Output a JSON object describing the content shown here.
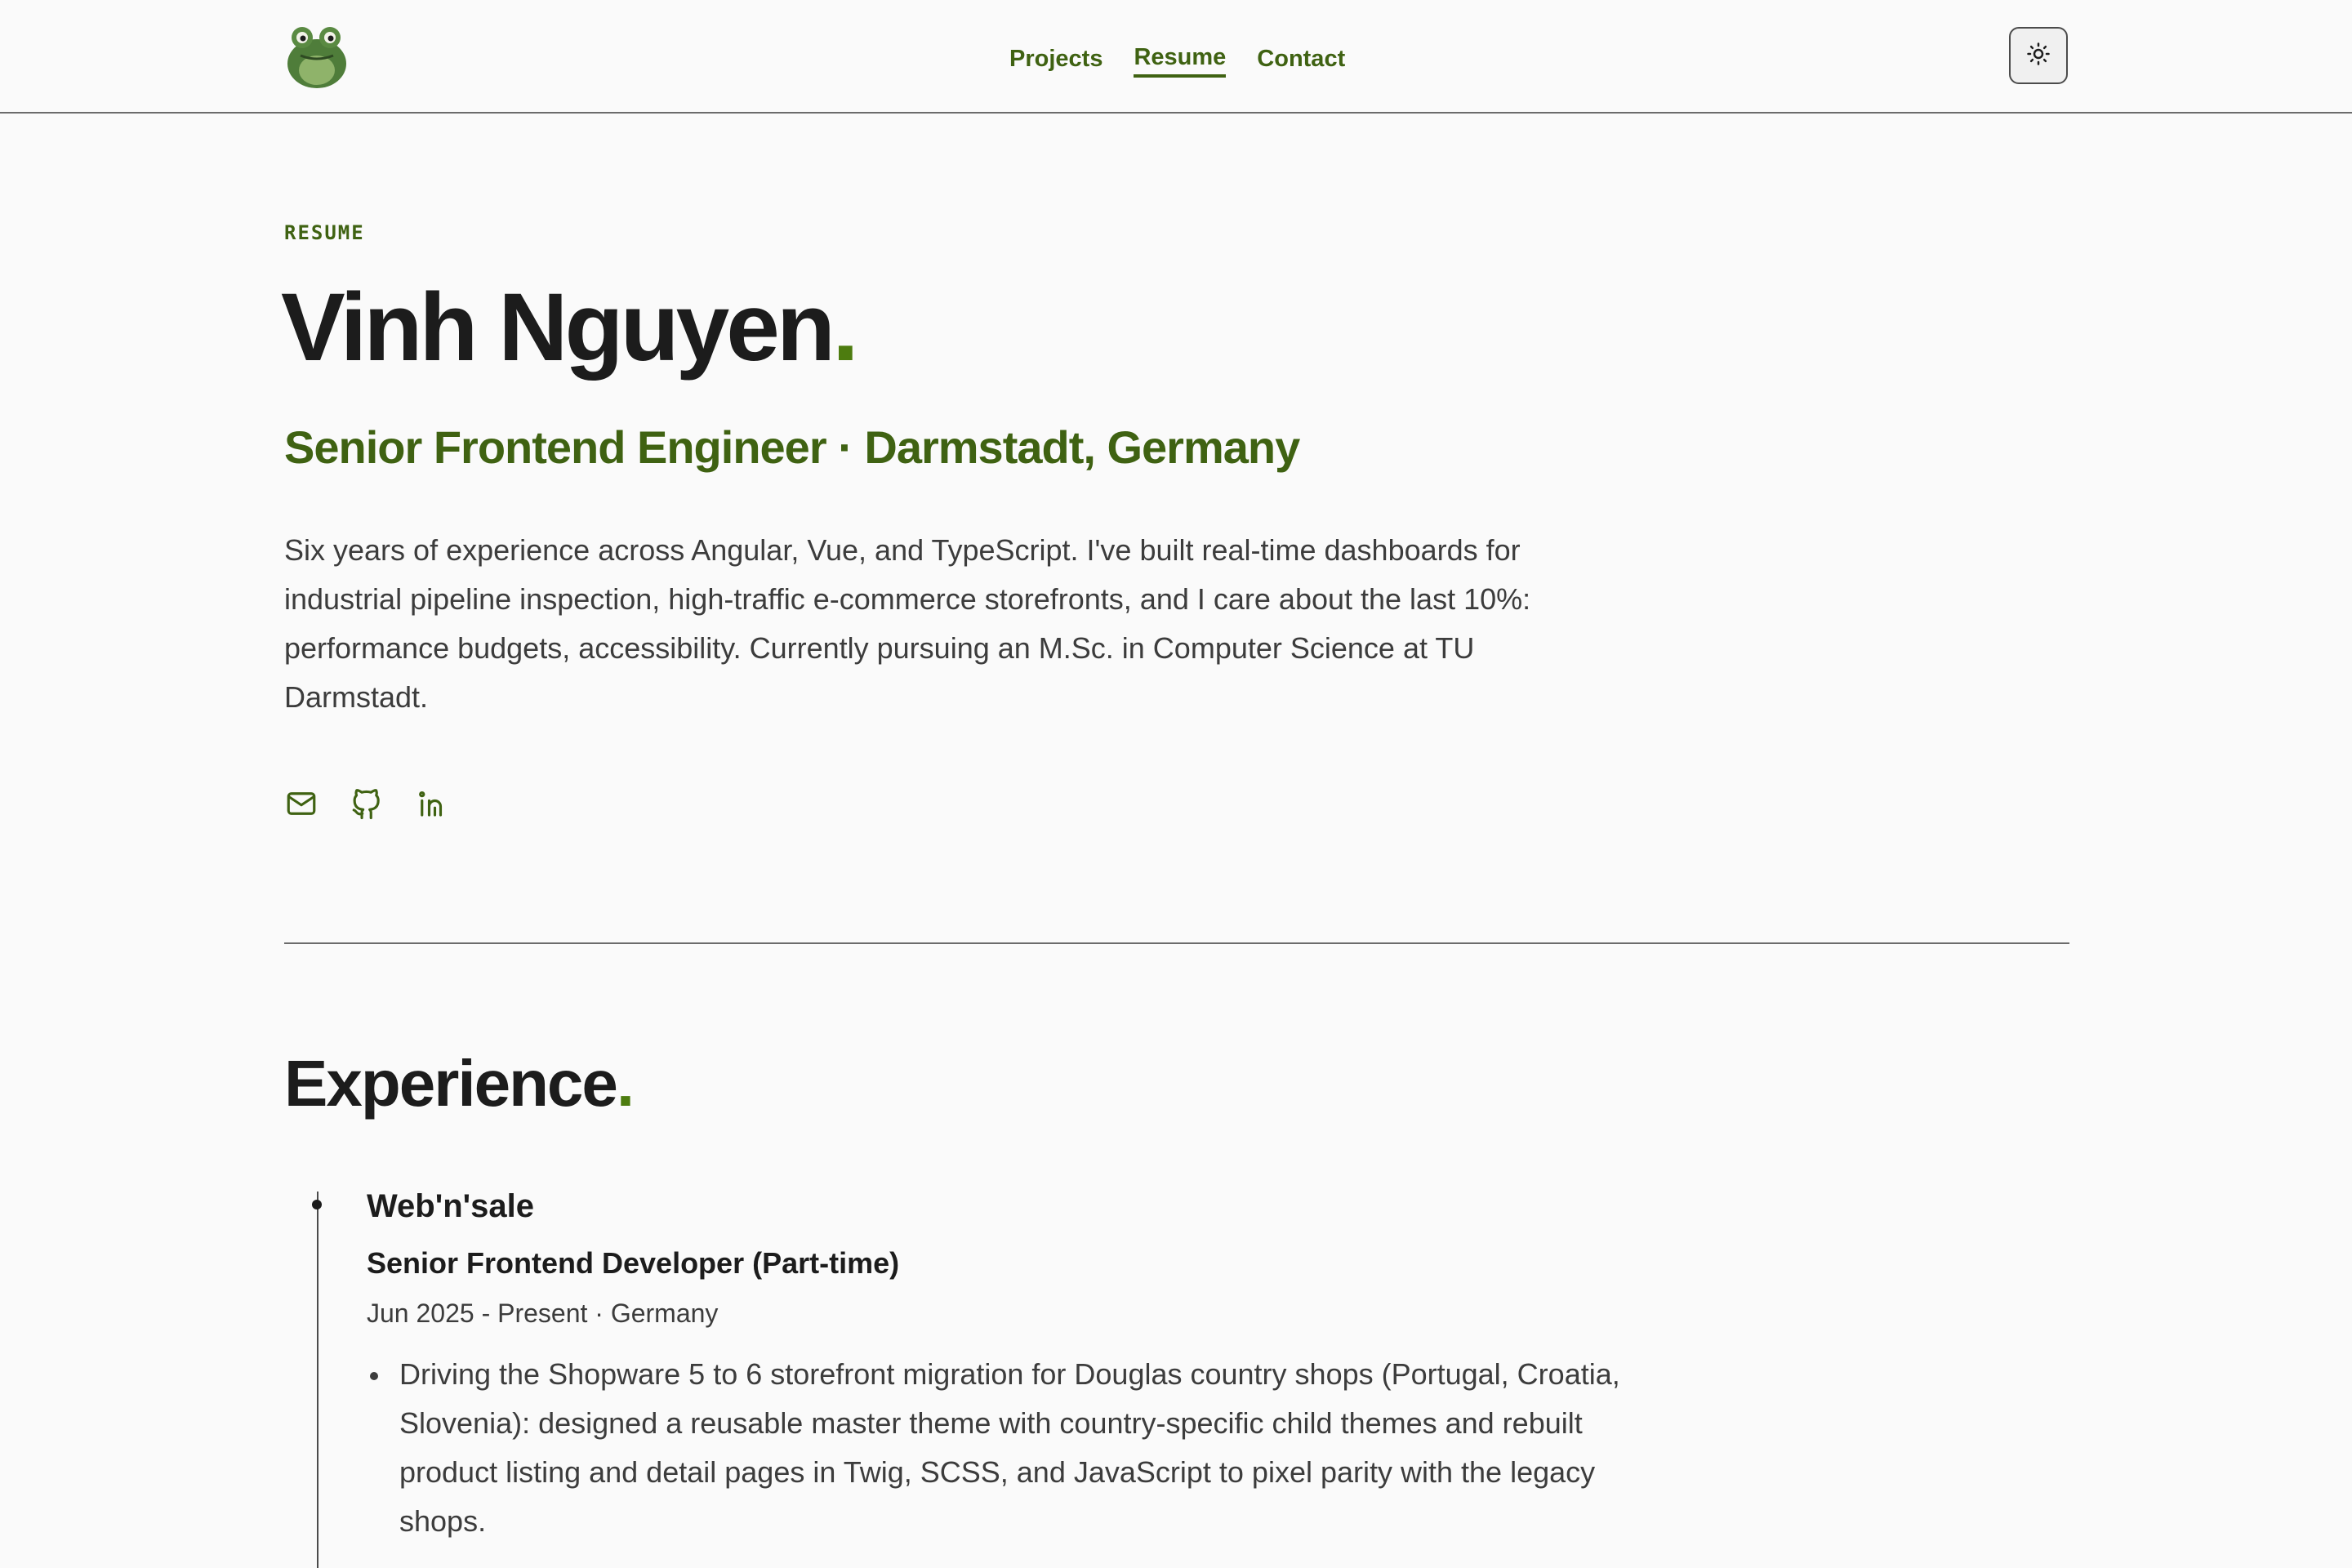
{
  "nav": {
    "links": [
      {
        "label": "Projects",
        "active": false
      },
      {
        "label": "Resume",
        "active": true
      },
      {
        "label": "Contact",
        "active": false
      }
    ],
    "logo_icon": "frog-avatar-icon",
    "theme_icon": "sun-icon"
  },
  "hero": {
    "eyebrow": "RESUME",
    "name": "Vinh Nguyen",
    "name_dot": ".",
    "subtitle": "Senior Frontend Engineer · Darmstadt, Germany",
    "bio": "Six years of experience across Angular, Vue, and TypeScript. I've built real-time dashboards for industrial pipeline inspection, high-traffic e-commerce storefronts, and I care about the last 10%: performance budgets, accessibility. Currently pursuing an M.Sc. in Computer Science at TU Darmstadt.",
    "social_icons": [
      "mail-icon",
      "github-icon",
      "linkedin-icon"
    ]
  },
  "experience": {
    "title": "Experience",
    "title_dot": ".",
    "jobs": [
      {
        "company": "Web'n'sale",
        "role": "Senior Frontend Developer (Part-time)",
        "meta": "Jun 2025 - Present · Germany",
        "bullets": [
          "Driving the Shopware 5 to 6 storefront migration for Douglas country shops (Portugal, Croatia, Slovenia): designed a reusable master theme with country-specific child themes and rebuilt product listing and detail pages in Twig, SCSS, and JavaScript to pixel parity with the legacy shops."
        ]
      }
    ]
  },
  "colors": {
    "accent": "#3f6212",
    "accent_dot": "#4d7c0f",
    "text": "#1c1c1c",
    "muted": "#3c3c3c",
    "background": "#fafafa"
  }
}
